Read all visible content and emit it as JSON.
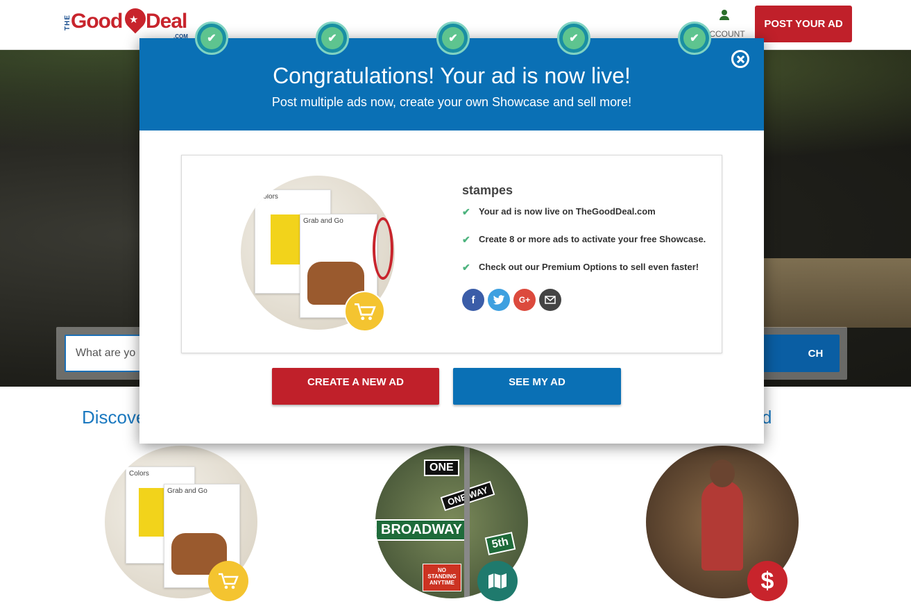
{
  "header": {
    "logo": {
      "the": "THE",
      "good": "Good",
      "deal": "Deal",
      "com": ".COM"
    },
    "account_label": "ACCOUNT",
    "post_ad_label": "POST YOUR AD"
  },
  "hero": {
    "search_placeholder": "What are you looking for?",
    "search_value": "What are yo",
    "search_button": "SEARCH",
    "search_button_visible": "CH"
  },
  "discover": {
    "title_visible_left": "Discove",
    "title_visible_right": "d"
  },
  "modal": {
    "title": "Congratulations! Your ad is now live!",
    "subtitle": "Post multiple ads now, create your own Showcase and sell more!",
    "steps_completed": 5,
    "ad_name": "stampes",
    "checklist": [
      "Your ad is now live on TheGoodDeal.com",
      "Create 8 or more ads to activate your free Showcase.",
      "Check out our Premium Options to sell even faster!"
    ],
    "social": [
      "facebook-icon",
      "twitter-icon",
      "google-plus-icon",
      "email-icon"
    ],
    "create_button": "CREATE A NEW AD",
    "see_button": "SEE MY AD"
  },
  "images": {
    "card_colors": "Colors",
    "card_grab": "Grab and Go",
    "sign_oneway": "ONE WAY",
    "sign_oneway_short": "ONE",
    "sign_broadway": "BROADWAY",
    "sign_fifth": "5th",
    "sign_nostanding": "NO STANDING ANYTIME",
    "dollar": "$"
  },
  "colors": {
    "brand_red": "#c0202a",
    "brand_blue": "#0a70b5",
    "check_green": "#5ec48f",
    "cart_yellow": "#f4c430"
  }
}
